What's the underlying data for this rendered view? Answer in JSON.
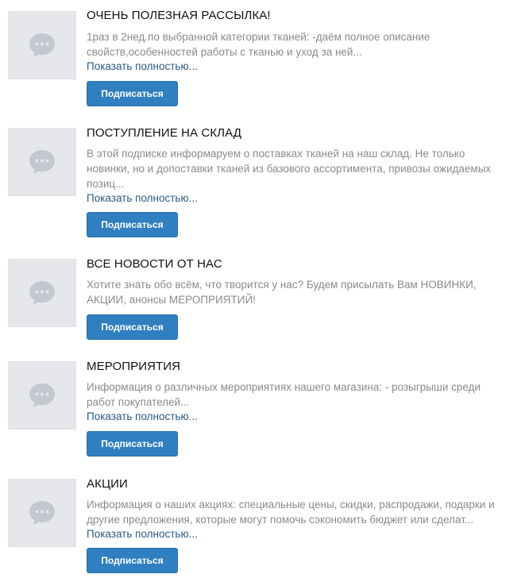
{
  "subscriptions": [
    {
      "title": "ОЧЕНЬ ПОЛЕЗНАЯ РАССЫЛКА!",
      "description": "1раз в 2нед.по выбранной категории тканей:  -даём полное описание\nсвойств,особенностей работы с тканью и уход за ней...",
      "more_label": "Показать полностью...",
      "subscribe_label": "Подписаться",
      "avatar_icon": "chat-bubble-icon"
    },
    {
      "title": "ПОСТУПЛЕНИЕ НА СКЛАД",
      "description": "В этой подписке информаруем о поставках тканей на наш склад. Не только\nновинки, но и допоставки тканей из базового ассортимента, привозы ожидаемых\nпозиц...",
      "more_label": "Показать полностью...",
      "subscribe_label": "Подписаться",
      "avatar_icon": "chat-bubble-icon"
    },
    {
      "title": "ВСЕ НОВОСТИ ОТ НАС",
      "description": "Хотите знать обо всём, что творится у нас? Будем присылать Вам НОВИНКИ,\nАКЦИИ, анонсы МЕРОПРИЯТИЙ!",
      "more_label": "",
      "subscribe_label": "Подписаться",
      "avatar_icon": "chat-bubble-icon"
    },
    {
      "title": "МЕРОПРИЯТИЯ",
      "description": "Информация о различных мероприятиях нашего магазина: - розыгрыши среди\nработ покупателей...",
      "more_label": "Показать полностью...",
      "subscribe_label": "Подписаться",
      "avatar_icon": "chat-bubble-icon"
    },
    {
      "title": "АКЦИИ",
      "description": "Информация о наших акциях: специальные цены, скидки, распродажи, подарки и\nдругие предложения, которые могут помочь сэкономить бюджет или сделат...",
      "more_label": "Показать полностью...",
      "subscribe_label": "Подписаться",
      "avatar_icon": "chat-bubble-icon"
    }
  ],
  "colors": {
    "button_bg": "#2f7fc1",
    "link": "#2a5885",
    "desc_text": "#8a8a8a",
    "avatar_bg": "#e6e7ea",
    "avatar_icon": "#c2c8d0"
  }
}
